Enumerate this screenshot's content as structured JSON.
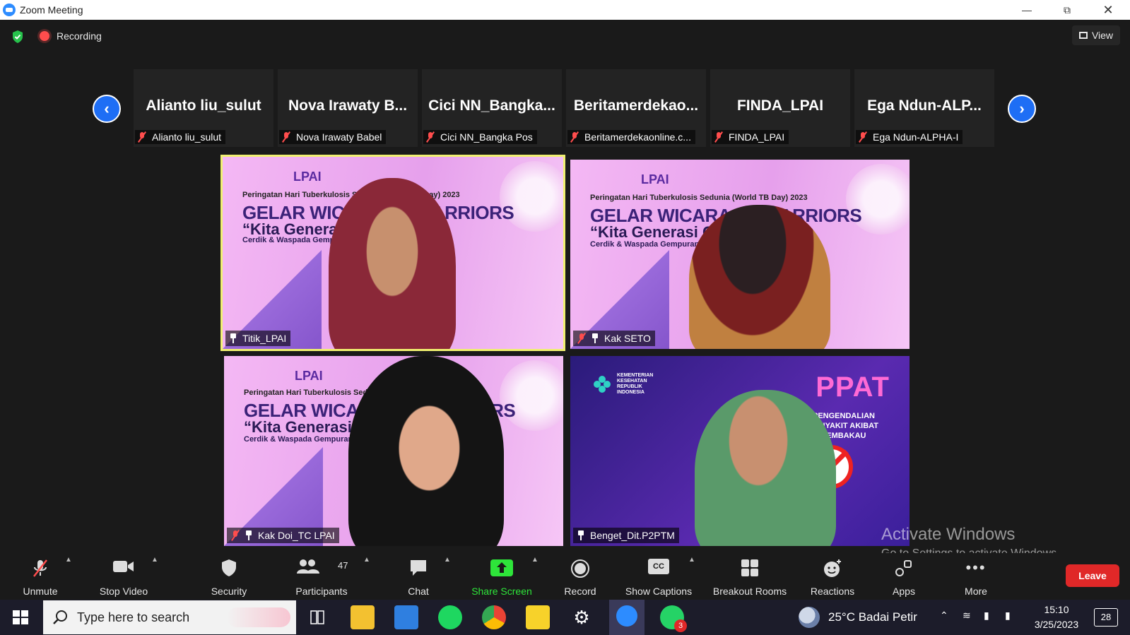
{
  "window": {
    "title": "Zoom Meeting"
  },
  "topbar": {
    "recording_label": "Recording",
    "view_label": "View"
  },
  "strip": [
    {
      "big": "Alianto liu_sulut",
      "label": "Alianto liu_sulut"
    },
    {
      "big": "Nova Irawaty B...",
      "label": "Nova Irawaty Babel"
    },
    {
      "big": "Cici NN_Bangka...",
      "label": "Cici NN_Bangka Pos"
    },
    {
      "big": "Beritamerdekao...",
      "label": "Beritamerdekaonline.c..."
    },
    {
      "big": "FINDA_LPAI",
      "label": "FINDA_LPAI"
    },
    {
      "big": "Ega Ndun-ALP...",
      "label": "Ega Ndun-ALPHA-I"
    }
  ],
  "slide": {
    "logo": "LPAI",
    "subtitle": "Peringatan Hari Tuberkulosis Sedunia (World TB Day) 2023",
    "headline": "GELAR WICARA TC WARRIORS",
    "tagline": "“Kita Generasi Cerdik”",
    "caption": "Cerdik & Waspada Gempuran Iklan Sponsor Rokok"
  },
  "ppat": {
    "ministry": [
      "KEMENTERIAN",
      "KESEHATAN",
      "REPUBLIK",
      "INDONESIA"
    ],
    "title": "PPAT",
    "lines": [
      "PENGENDALIAN",
      "PENYAKIT AKIBAT",
      "TEMBAKAU"
    ]
  },
  "videos": [
    {
      "name": "Titik_LPAI"
    },
    {
      "name": "Kak SETO"
    },
    {
      "name": "Kak Doi_TC LPAI"
    },
    {
      "name": "Benget_Dit.P2PTM"
    }
  ],
  "watermark": {
    "line1": "Activate Windows",
    "line2": "Go to Settings to activate Windows."
  },
  "toolbar": {
    "unmute": "Unmute",
    "stop_video": "Stop Video",
    "security": "Security",
    "participants": "Participants",
    "participants_count": "47",
    "chat": "Chat",
    "share_screen": "Share Screen",
    "record": "Record",
    "show_captions": "Show Captions",
    "breakout_rooms": "Breakout Rooms",
    "reactions": "Reactions",
    "apps": "Apps",
    "more": "More",
    "leave": "Leave",
    "cc": "CC"
  },
  "taskbar": {
    "search_placeholder": "Type here to search",
    "weather": "25°C  Badai Petir",
    "time": "15:10",
    "date": "3/25/2023",
    "notification_count": "28",
    "whatsapp_badge": "3"
  }
}
